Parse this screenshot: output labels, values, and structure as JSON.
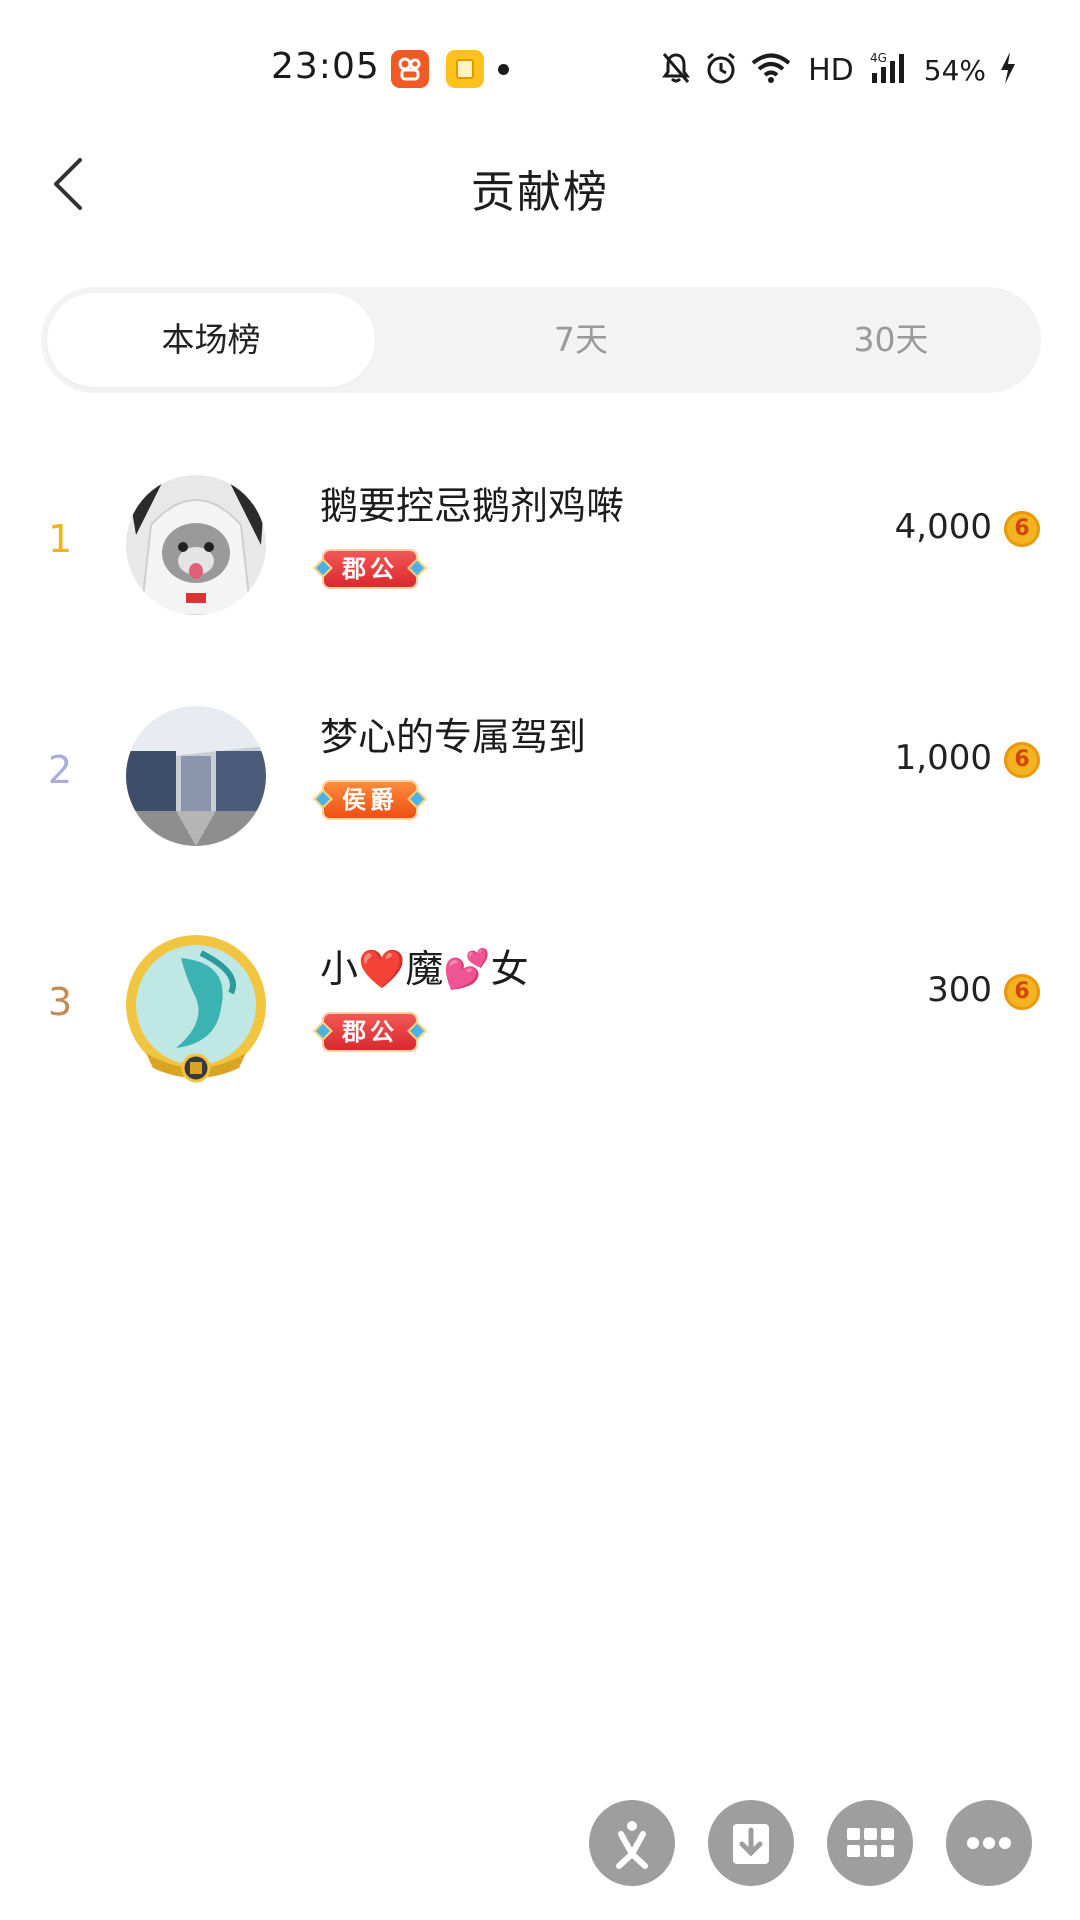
{
  "status_bar": {
    "time": "23:05",
    "network": "HD",
    "signal": "4G",
    "battery": "54%",
    "icons": [
      "app-orange-icon",
      "app-yellow-icon",
      "notification-dot-icon",
      "bell-muted-icon",
      "alarm-icon",
      "wifi-icon",
      "signal-icon",
      "charging-icon"
    ]
  },
  "header": {
    "title": "贡献榜",
    "back_icon": "chevron-left-icon"
  },
  "tabs": [
    {
      "label": "本场榜",
      "selected": true
    },
    {
      "label": "7天",
      "selected": false
    },
    {
      "label": "30天",
      "selected": false
    }
  ],
  "ranking": [
    {
      "rank": "1",
      "name": "鹅要控忌鹅剂鸡啭",
      "badge": "郡公",
      "score": "4,000",
      "rank_color": "#f0b31a"
    },
    {
      "rank": "2",
      "name": "梦心的专属驾到",
      "badge": "侯爵",
      "score": "1,000",
      "rank_color": "#a9acdd"
    },
    {
      "rank": "3",
      "name": "小❤️魔💕女",
      "badge": "郡公",
      "score": "300",
      "rank_color": "#c48a55"
    }
  ],
  "coin_glyph": "6",
  "floating_actions": [
    "share-icon",
    "download-icon",
    "grid-icon",
    "more-icon"
  ],
  "colors": {
    "accent_gold": "#f0b31a",
    "tab_bg": "#f3f3f3",
    "fab_bg": "#9e9e9e",
    "badge_red": "#e03a3a",
    "badge_orange": "#f2651f"
  }
}
